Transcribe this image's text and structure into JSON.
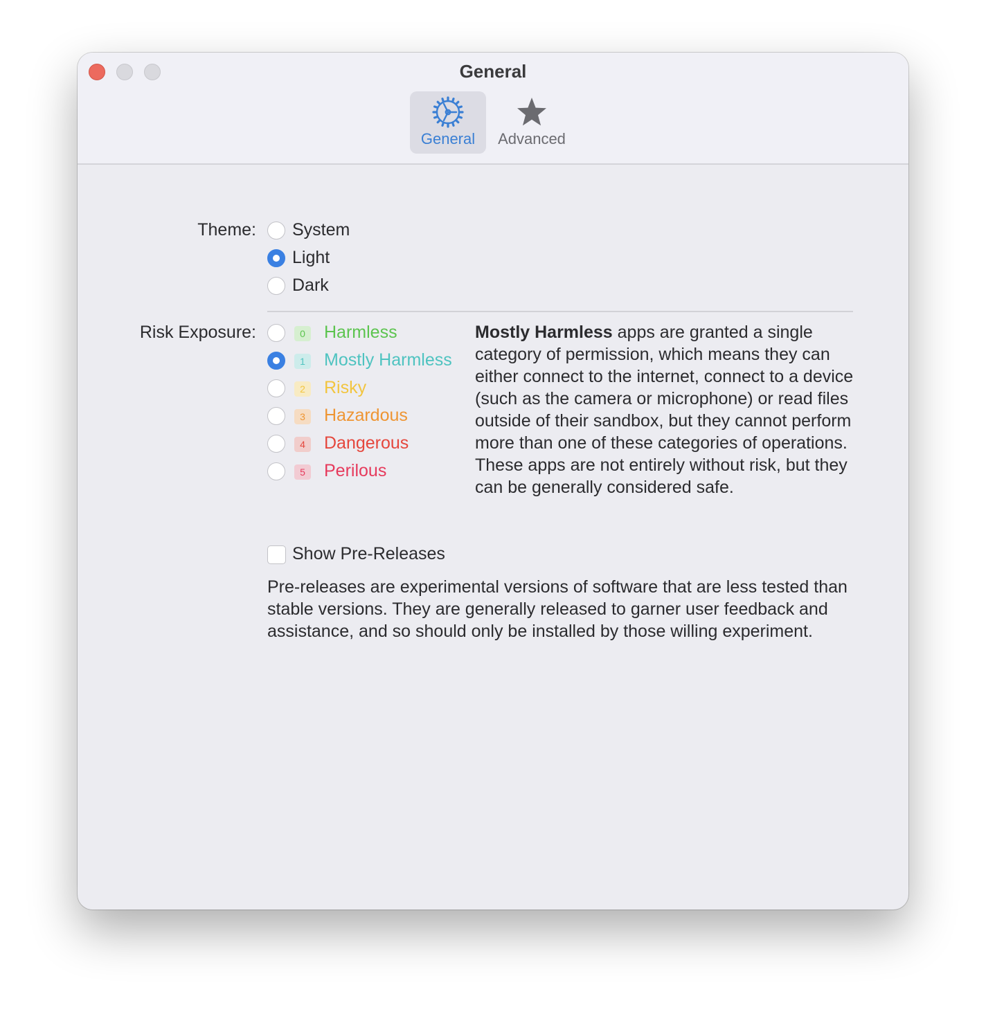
{
  "window": {
    "title": "General"
  },
  "toolbar": {
    "tabs": [
      {
        "label": "General",
        "icon": "gear-icon",
        "selected": true
      },
      {
        "label": "Advanced",
        "icon": "star-icon",
        "selected": false
      }
    ]
  },
  "theme": {
    "label": "Theme:",
    "options": [
      "System",
      "Light",
      "Dark"
    ],
    "selected": "Light"
  },
  "risk": {
    "label": "Risk Exposure:",
    "selected": "Mostly Harmless",
    "levels": [
      {
        "num": "0",
        "name": "Harmless",
        "color": "#5cc44f",
        "badge_bg": "#d6efd0"
      },
      {
        "num": "1",
        "name": "Mostly Harmless",
        "color": "#4ec3c0",
        "badge_bg": "#cdeceb"
      },
      {
        "num": "2",
        "name": "Risky",
        "color": "#f2c53f",
        "badge_bg": "#f8ebc3"
      },
      {
        "num": "3",
        "name": "Hazardous",
        "color": "#ee9533",
        "badge_bg": "#f6dcc2"
      },
      {
        "num": "4",
        "name": "Dangerous",
        "color": "#e5473d",
        "badge_bg": "#f1cdcb"
      },
      {
        "num": "5",
        "name": "Perilous",
        "color": "#e63a5c",
        "badge_bg": "#f2cbd3"
      }
    ],
    "description_bold": "Mostly Harmless",
    "description_rest": " apps are granted a single category of permission, which means they can either connect to the internet, connect to a device (such as the camera or microphone) or read files outside of their sandbox, but they cannot perform more than one of these categories of operations. These apps are not entirely without risk, but they can be generally considered safe."
  },
  "prereleases": {
    "label": "Show Pre-Releases",
    "checked": false,
    "description": "Pre-releases are experimental versions of software that are less tested than stable versions. They are generally released to garner user feedback and assistance, and so should only be installed by those willing experiment."
  },
  "colors": {
    "accent": "#3a80e2",
    "close_button": "#ec6a5e"
  }
}
